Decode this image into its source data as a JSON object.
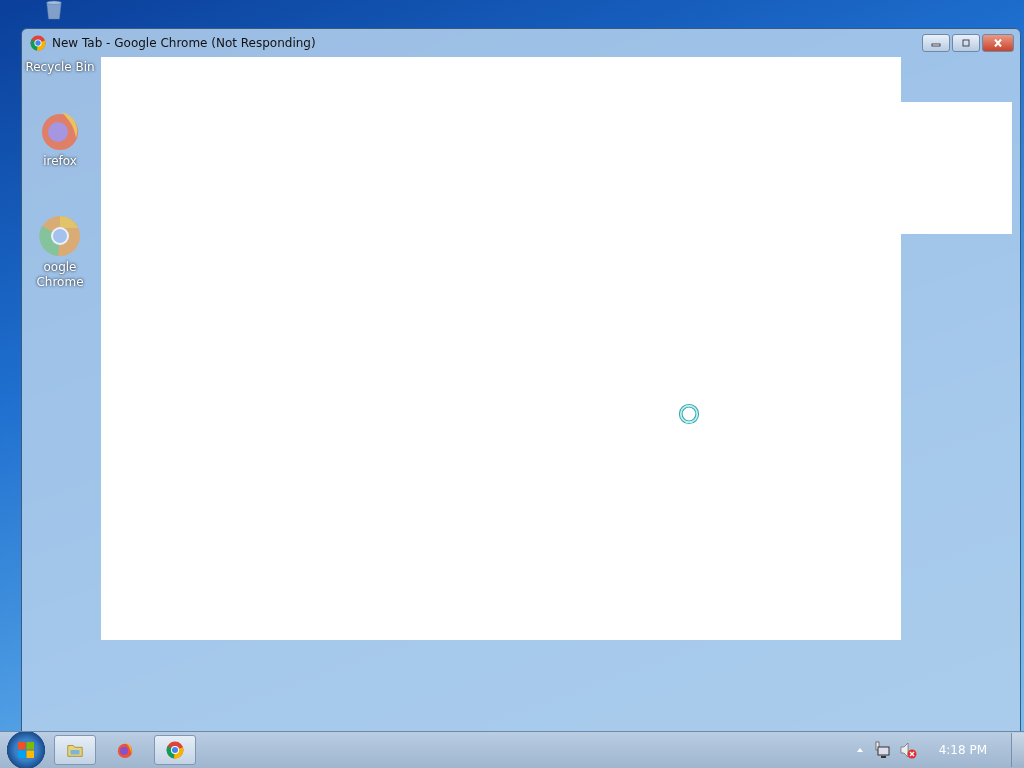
{
  "desktop_icons": [
    {
      "kind": "recycle-bin",
      "label": "Recycle Bin"
    },
    {
      "kind": "firefox",
      "label": "irefox"
    },
    {
      "kind": "chrome",
      "label": "oogle Chrome"
    }
  ],
  "window": {
    "title": "New Tab - Google Chrome (Not Responding)"
  },
  "taskbar": {
    "items": [
      {
        "kind": "folder",
        "running": true
      },
      {
        "kind": "firefox",
        "running": false
      },
      {
        "kind": "chrome",
        "running": true
      }
    ],
    "clock": "4:18 PM"
  }
}
